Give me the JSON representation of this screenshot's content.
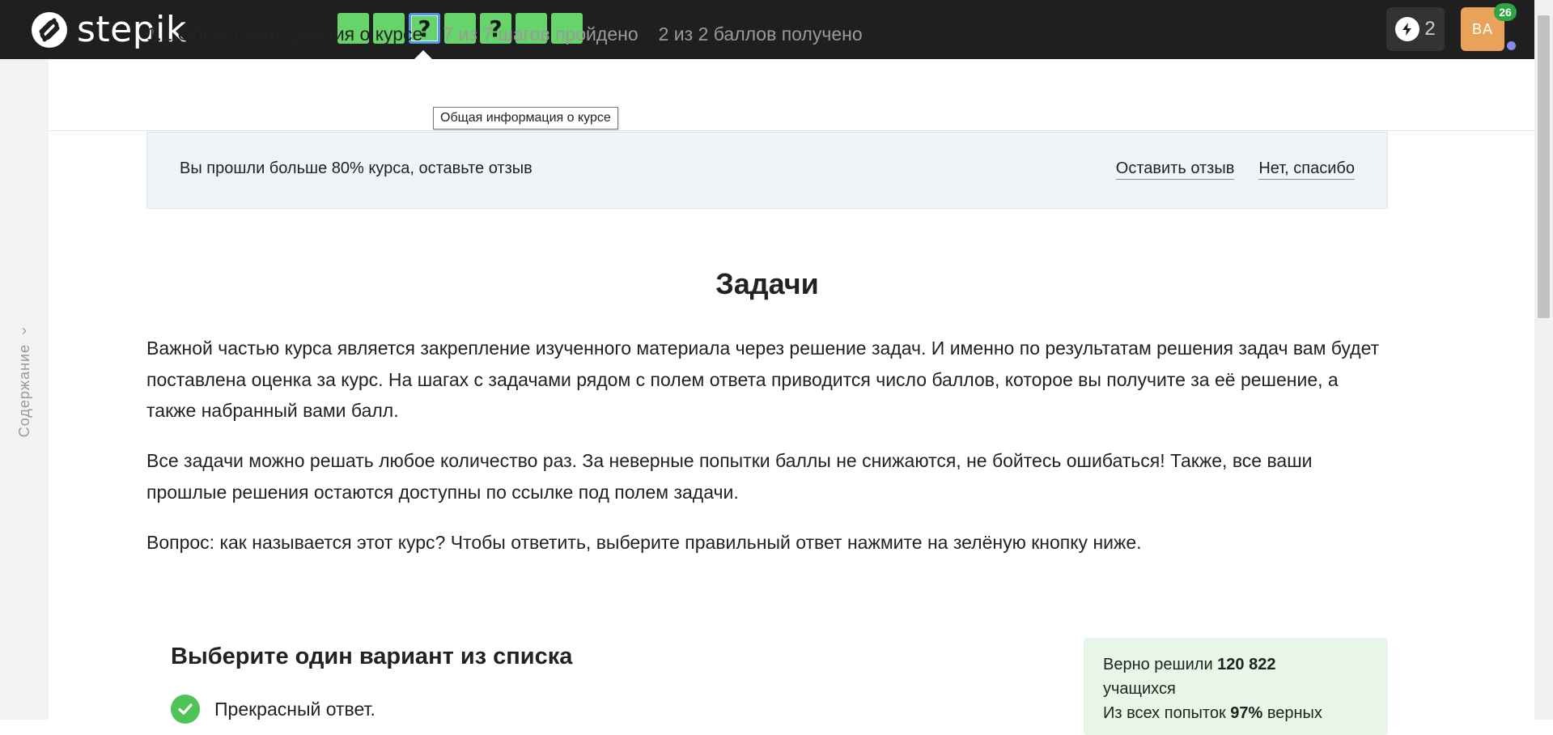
{
  "app": {
    "logo_text": "stepik"
  },
  "steps": [
    {
      "glyph": "",
      "state": "passed"
    },
    {
      "glyph": "",
      "state": "passed"
    },
    {
      "glyph": "?",
      "state": "active"
    },
    {
      "glyph": "",
      "state": "passed"
    },
    {
      "glyph": "?",
      "state": "passed"
    },
    {
      "glyph": "",
      "state": "passed"
    },
    {
      "glyph": "",
      "state": "passed"
    }
  ],
  "header_right": {
    "energy_count": "2",
    "avatar_initials": "BA",
    "notification_count": "26"
  },
  "sidebar": {
    "toc_label": "Содержание"
  },
  "lesson": {
    "title": "1.1 Общая информация о курсе",
    "progress": "7 из 7 шагов пройдено",
    "score": "2 из 2 баллов  получено",
    "tooltip": "Общая информация о курсе"
  },
  "banner": {
    "text": "Вы прошли больше 80% курса, оставьте отзыв",
    "leave_review": "Оставить отзыв",
    "no_thanks": "Нет, спасибо"
  },
  "content": {
    "heading": "Задачи",
    "paragraph1": "Важной частью курса является закрепление изученного материала через решение задач. И именно по результатам решения задач вам будет поставлена оценка за курс. На шагах с задачами рядом с полем ответа приводится число баллов, которое вы получите за её решение, а также набранный вами балл.",
    "paragraph2": "Все задачи можно решать любое количество раз. За неверные попытки баллы не снижаются, не бойтесь ошибаться! Также, все ваши прошлые решения остаются доступны по ссылке под полем задачи.",
    "paragraph3": "Вопрос: как называется этот курс? Чтобы ответить, выберите правильный ответ нажмите на зелёную кнопку ниже."
  },
  "quiz": {
    "title": "Выберите один вариант из списка",
    "option1": "Прекрасный ответ."
  },
  "stats": {
    "solved_prefix": "Верно решили ",
    "solved_count": "120 822",
    "solved_suffix": "учащихся",
    "attempts_prefix": "Из всех попыток ",
    "attempts_percent": "97%",
    "attempts_suffix": " верных"
  },
  "colors": {
    "topbar": "#1f1f1f",
    "step_green": "#66d46a",
    "step_active_border": "#4da0e0",
    "avatar": "#e8a25a",
    "badge_green": "#2fa542",
    "banner_bg": "#eef4f7",
    "stats_bg": "#e7f6e7"
  }
}
